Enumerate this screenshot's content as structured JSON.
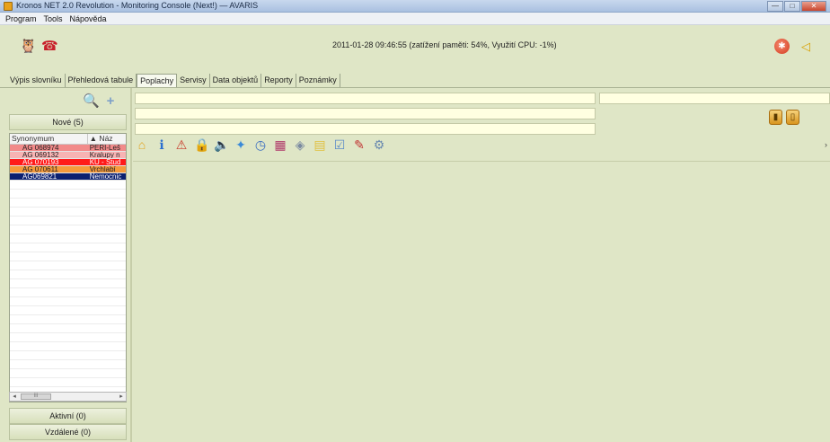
{
  "window": {
    "title": "Kronos NET 2.0 Revolution - Monitoring Console (Next!) — AVARIS",
    "controls": [
      "—",
      "□",
      "✕"
    ]
  },
  "menu": [
    "Program",
    "Tools",
    "Nápověda"
  ],
  "header": {
    "left_icons": [
      "owl-icon",
      "phone-icon"
    ],
    "status": "2011-01-28 09:46:55 (zatížení paměti: 54%, Využití CPU: -1%)",
    "right_icons": [
      "alarm-icon",
      "horn-icon"
    ]
  },
  "tabs": [
    {
      "label": "Výpis slovníku",
      "active": false
    },
    {
      "label": "Přehledová tabule",
      "active": false
    },
    {
      "label": "Poplachy",
      "active": true
    },
    {
      "label": "Servisy",
      "active": false
    },
    {
      "label": "Data objektů",
      "active": false
    },
    {
      "label": "Reporty",
      "active": false
    },
    {
      "label": "Poznámky",
      "active": false
    }
  ],
  "left_panel": {
    "tools": [
      "search-icon",
      "add-icon"
    ],
    "new_section": "Nové (5)",
    "grid": {
      "columns": [
        "Synonymum",
        "▲ Náz"
      ],
      "rows": [
        {
          "synonym": "AG 068974",
          "name": "PERI-Leš",
          "bg": "#f28a8a",
          "fg": "#222222"
        },
        {
          "synonym": "AG 069132",
          "name": "Kralupy n",
          "bg": "#f7b3b3",
          "fg": "#222222"
        },
        {
          "synonym": "AG 070193",
          "name": "KU - Stud",
          "bg": "#ff1a1a",
          "fg": "#ffffff"
        },
        {
          "synonym": "AG 070611",
          "name": "Vrchlabí",
          "bg": "#f59a3c",
          "fg": "#222222"
        },
        {
          "synonym": "AG069821",
          "name": "Nemocnic",
          "bg": "#0b2070",
          "fg": "#ffffff"
        }
      ]
    },
    "scroll_thumb": "III",
    "active_section": "Aktivní (0)",
    "remote_section": "Vzdálené (0)"
  },
  "main": {
    "side_buttons": [
      "bin-icon",
      "bin-open-icon"
    ],
    "toolbar": [
      "house-icon",
      "info-icon",
      "warning-house-icon",
      "lock-icon",
      "speaker-icon",
      "puzzle-icon",
      "clock-icon",
      "chart-icon",
      "tag-icon",
      "document-icon",
      "checklist-icon",
      "pen-icon",
      "tools-icon"
    ],
    "more_indicator": "›"
  }
}
